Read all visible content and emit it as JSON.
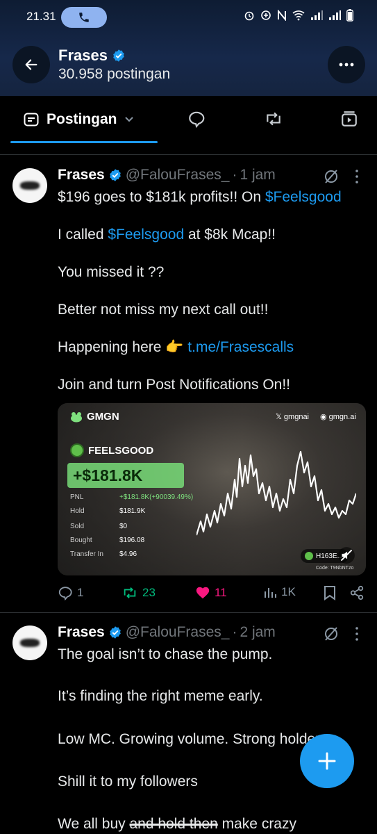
{
  "status_bar": {
    "time": "21.31"
  },
  "header": {
    "title": "Frases",
    "subtitle": "30.958 postingan"
  },
  "tabs": {
    "active_label": "Postingan"
  },
  "posts": [
    {
      "name": "Frases",
      "handle": "@FalouFrases_",
      "time": "1 jam",
      "lines": {
        "l1_pre": "$196 goes to $181k profits!! On ",
        "l1_link": "$Feelsgood",
        "l2_pre": "I called ",
        "l2_link": "$Feelsgood",
        "l2_post": " at $8k Mcap!!",
        "l3": "You missed it ??",
        "l4": "Better not miss my next call out!!",
        "l5_pre": "Happening here 👉 ",
        "l5_link": "t.me/Frasescalls",
        "l6": "Join and turn Post Notifications On!!"
      },
      "media": {
        "brand": "GMGN",
        "x_handle": "gmgnai",
        "site": "gmgn.ai",
        "token": "FEELSGOOD",
        "profit": "+$181.8K",
        "stats": [
          {
            "label": "PNL",
            "value": "+$181.8K(+90039.49%)"
          },
          {
            "label": "Hold",
            "value": "$181.9K"
          },
          {
            "label": "Sold",
            "value": "$0"
          },
          {
            "label": "Bought",
            "value": "$196.08"
          },
          {
            "label": "Transfer In",
            "value": "$4.96"
          }
        ],
        "badge": "H163E...j",
        "code": "Code: T9NbNTzo"
      },
      "stats": {
        "replies": "1",
        "reposts": "23",
        "likes": "11",
        "views": "1K"
      }
    },
    {
      "name": "Frases",
      "handle": "@FalouFrases_",
      "time": "2 jam",
      "lines": {
        "l1": "The goal isn’t to chase the pump.",
        "l2": "It’s finding the right meme early.",
        "l3": "Low MC. Growing volume. Strong holders.",
        "l4": "Shill it to my followers",
        "l5_pre": "We all buy ",
        "l5_strike": "and hold then",
        "l5_post": " make crazy"
      }
    }
  ],
  "colors": {
    "accent": "#1d9bf0",
    "repost": "#00ba7c",
    "like": "#f91880"
  }
}
